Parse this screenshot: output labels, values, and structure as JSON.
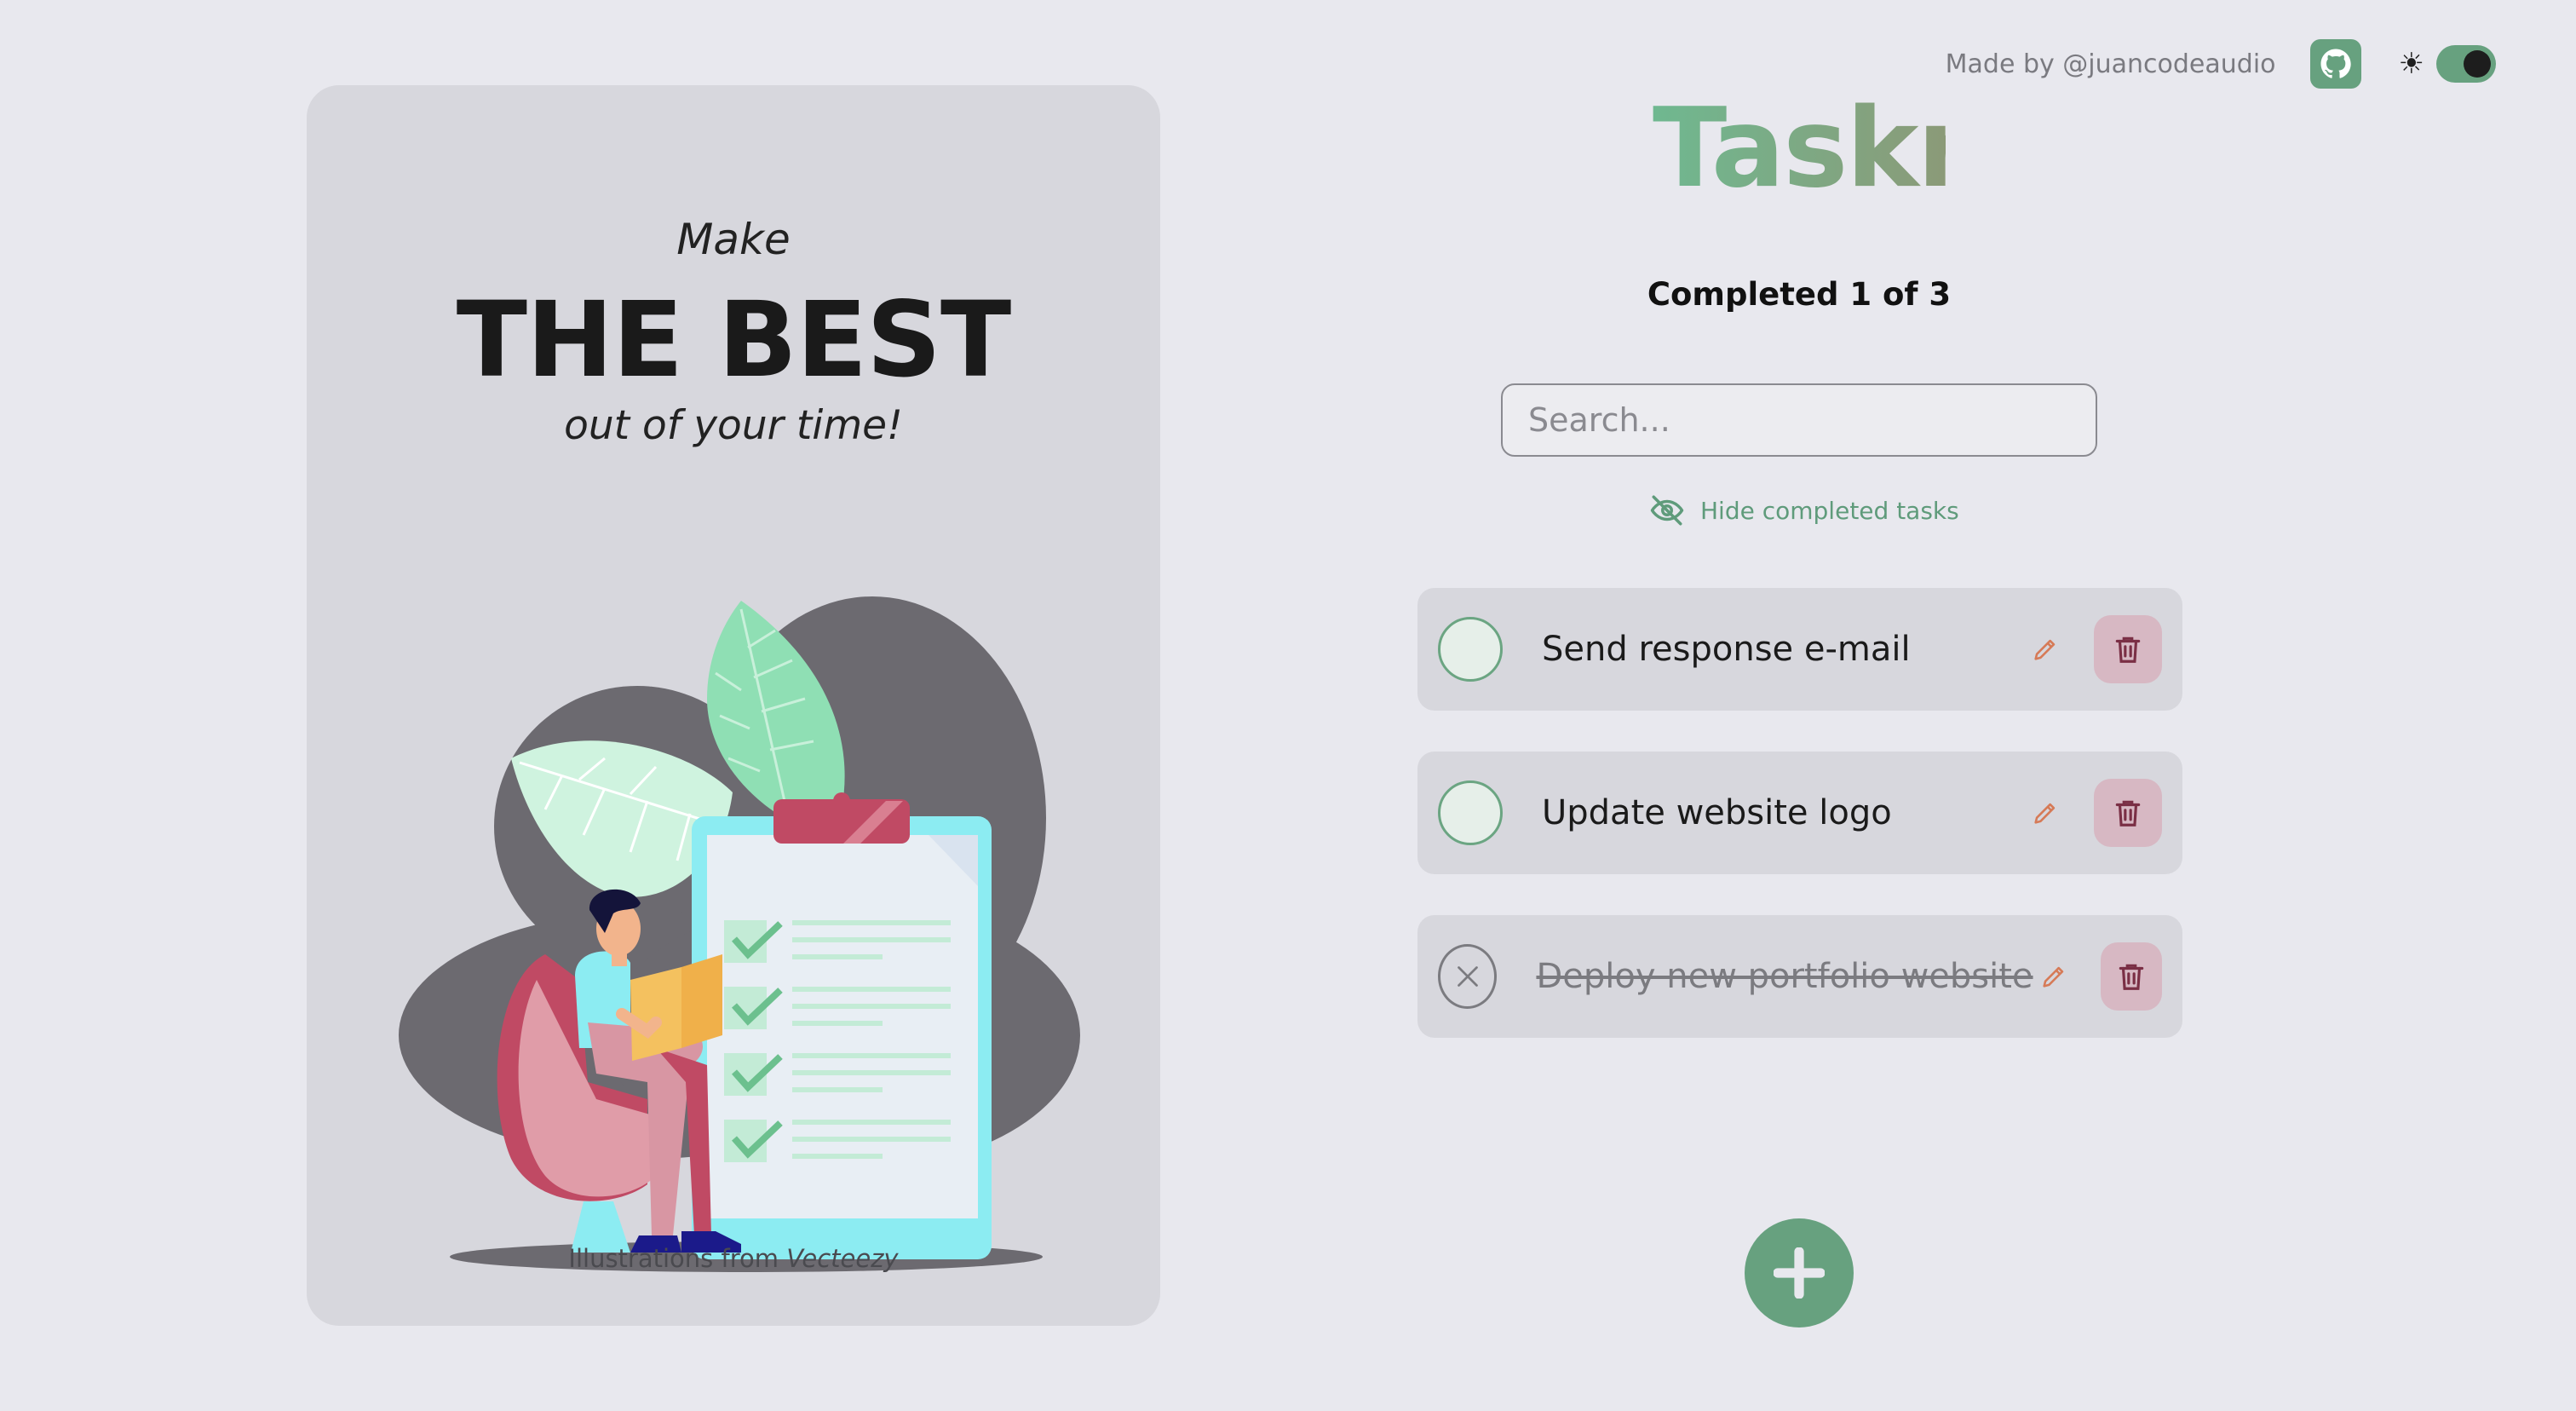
{
  "header": {
    "made_by": "Made by @juancodeaudio",
    "theme_icon": "sun-icon"
  },
  "hero": {
    "make": "Make",
    "best": "THE BEST",
    "out_of": "out of your time!",
    "credit_prefix": "Illustrations from",
    "credit_source": "Vecteezy"
  },
  "app": {
    "title": "Taskr",
    "completed": "Completed 1 of 3",
    "search_placeholder": "Search...",
    "hide_label": "Hide completed tasks"
  },
  "tasks": [
    {
      "text": "Send response e-mail",
      "completed": false
    },
    {
      "text": "Update website logo",
      "completed": false
    },
    {
      "text": "Deploy new portfolio website",
      "completed": true
    }
  ],
  "colors": {
    "accent": "#67a17f",
    "edit": "#d67a57",
    "delete_bg": "#d7b8c3",
    "delete_icon": "#7a2f45"
  }
}
